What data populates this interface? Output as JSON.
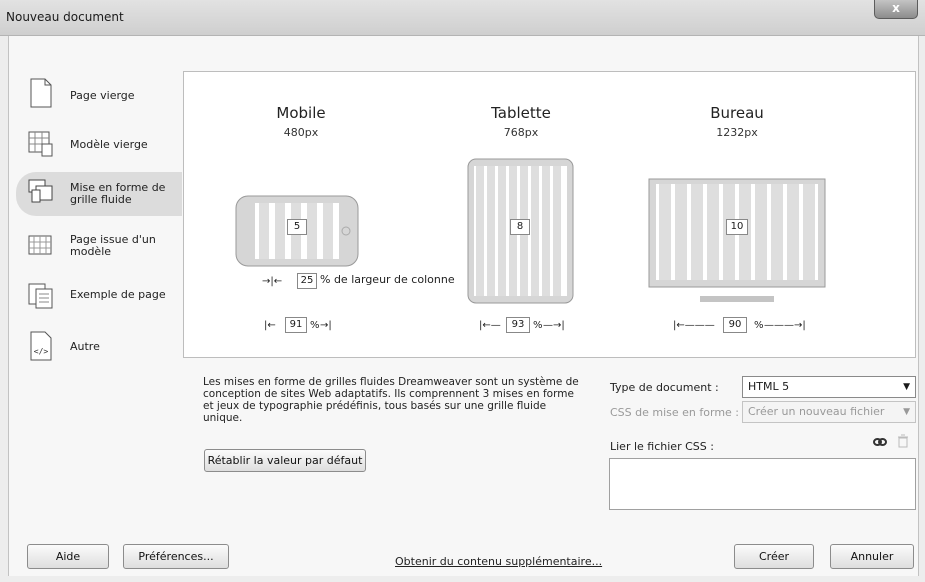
{
  "window": {
    "title": "Nouveau document",
    "close_label": "x"
  },
  "categories": [
    {
      "label": "Page vierge",
      "icon": "blank-page-icon"
    },
    {
      "label": "Modèle vierge",
      "icon": "blank-template-icon"
    },
    {
      "label": "Mise en forme de grille fluide",
      "icon": "fluid-grid-icon",
      "selected": true
    },
    {
      "label": "Page issue d'un modèle",
      "icon": "page-from-template-icon"
    },
    {
      "label": "Exemple de page",
      "icon": "sample-page-icon"
    },
    {
      "label": "Autre",
      "icon": "other-code-icon"
    }
  ],
  "devices": {
    "mobile": {
      "name": "Mobile",
      "px": "480px",
      "columns": "5",
      "width": "91",
      "unit": "%"
    },
    "tablet": {
      "name": "Tablette",
      "px": "768px",
      "columns": "8",
      "width": "93",
      "unit": "%"
    },
    "desktop": {
      "name": "Bureau",
      "px": "1232px",
      "columns": "10",
      "width": "90",
      "unit": "%"
    }
  },
  "gutter": {
    "value": "25",
    "label": "% de largeur de colonne"
  },
  "description": "Les mises en forme de grilles fluides Dreamweaver sont un système de conception de sites Web adaptatifs. Ils comprennent 3 mises en forme et jeux de typographie prédéfinis, tous basés sur une grille fluide unique.",
  "reset_button": "Rétablir la valeur par défaut",
  "doc_type": {
    "label": "Type de document :",
    "value": "HTML 5"
  },
  "css_layout": {
    "label": "CSS de mise en forme :",
    "value": "Créer un nouveau fichier"
  },
  "attach_css": {
    "label": "Lier le fichier CSS :"
  },
  "footer": {
    "help": "Aide",
    "preferences": "Préférences...",
    "more_content": "Obtenir du contenu supplémentaire...",
    "create": "Créer",
    "cancel": "Annuler"
  }
}
